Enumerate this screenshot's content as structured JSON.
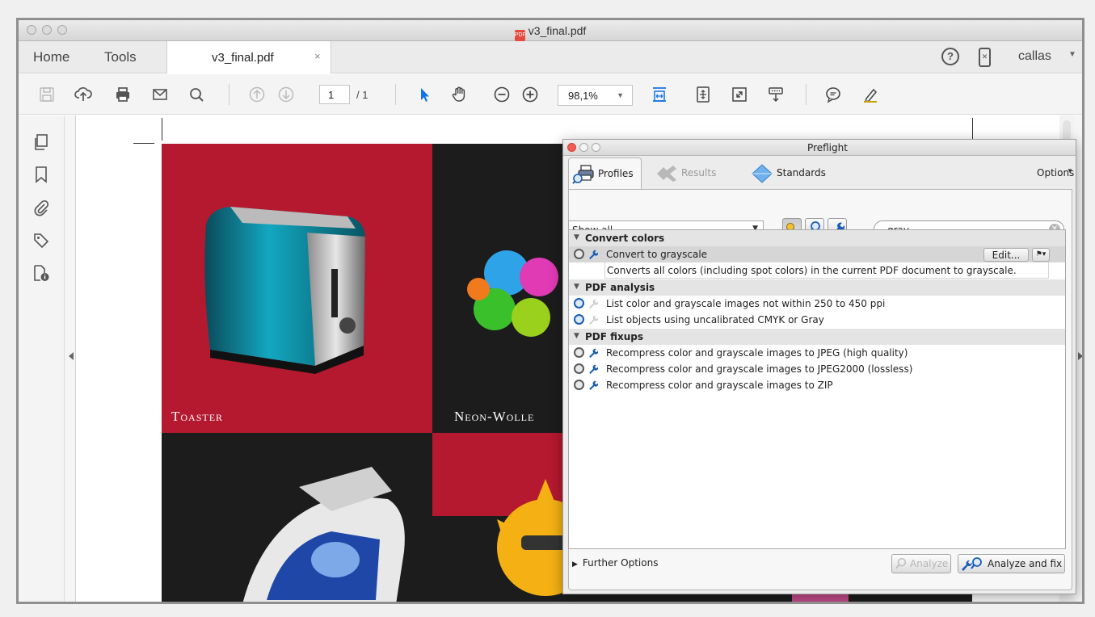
{
  "window": {
    "title": "v3_final.pdf"
  },
  "nav": {
    "home": "Home",
    "tools": "Tools"
  },
  "tab": {
    "label": "v3_final.pdf",
    "close": "×"
  },
  "user": {
    "name": "callas"
  },
  "toolbar": {
    "page_current": "1",
    "page_total": "/ 1",
    "zoom": "98,1%"
  },
  "document": {
    "captions": [
      "Toaster",
      "Neon-Wolle"
    ],
    "colors": {
      "red": "#b5192f",
      "black": "#1c1c1c"
    }
  },
  "preflight": {
    "title": "Preflight",
    "tabs": [
      {
        "label": "Profiles",
        "icon": "printer-magnifier-icon",
        "active": true
      },
      {
        "label": "Results",
        "icon": "results-icon",
        "active": false
      },
      {
        "label": "Standards",
        "icon": "diamond-icon",
        "active": false
      }
    ],
    "options_label": "Options",
    "filter_select": "Show all",
    "search_value": "gray",
    "groups": [
      {
        "title": "Convert colors",
        "items": [
          {
            "label": "Convert to grayscale",
            "description": "Converts all colors (including spot colors) in the current PDF document to grayscale.",
            "selected": true,
            "edit_label": "Edit..."
          }
        ]
      },
      {
        "title": "PDF analysis",
        "items": [
          {
            "label": "List color and grayscale images not within 250 to 450 ppi"
          },
          {
            "label": "List objects using uncalibrated CMYK or Gray"
          }
        ]
      },
      {
        "title": "PDF fixups",
        "items": [
          {
            "label": "Recompress color and grayscale images to JPEG (high quality)"
          },
          {
            "label": "Recompress color and grayscale images to JPEG2000 (lossless)"
          },
          {
            "label": "Recompress color and grayscale images to ZIP"
          }
        ]
      }
    ],
    "further_options": "Further Options",
    "analyze_label": "Analyze",
    "analyze_fix_label": "Analyze and fix"
  }
}
